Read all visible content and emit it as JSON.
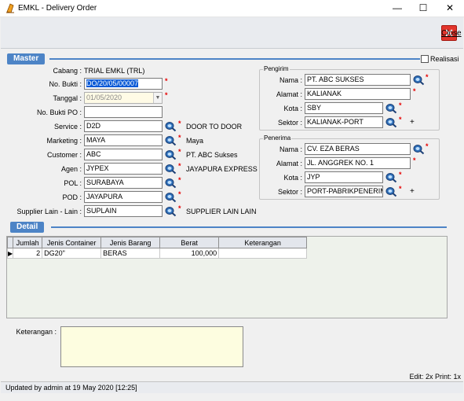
{
  "window": {
    "title": "EMKL - Delivery Order",
    "minimize": "—",
    "maximize": "☐",
    "close": "✕"
  },
  "toolbar": {
    "close_label": "Close"
  },
  "master": {
    "section_label": "Master",
    "realisasi_label": "Realisasi",
    "cabang_label": "Cabang :",
    "cabang_value": "TRIAL EMKL (TRL)",
    "no_bukti_label": "No. Bukti :",
    "no_bukti_value": "DO/20/05/00007",
    "tanggal_label": "Tanggal :",
    "tanggal_value": "01/05/2020",
    "no_bukti_po_label": "No. Bukti PO :",
    "no_bukti_po_value": "",
    "service_label": "Service :",
    "service_value": "D2D",
    "service_desc": "DOOR TO DOOR",
    "marketing_label": "Marketing :",
    "marketing_value": "MAYA",
    "marketing_desc": "Maya",
    "customer_label": "Customer :",
    "customer_value": "ABC",
    "customer_desc": "PT. ABC Sukses",
    "agen_label": "Agen :",
    "agen_value": "JYPEX",
    "agen_desc": "JAYAPURA EXPRESS",
    "pol_label": "POL :",
    "pol_value": "SURABAYA",
    "pod_label": "POD :",
    "pod_value": "JAYAPURA",
    "supplier_label": "Supplier Lain - Lain :",
    "supplier_value": "SUPLAIN",
    "supplier_desc": "SUPPLIER LAIN LAIN"
  },
  "pengirim": {
    "title": "Pengirim",
    "nama_label": "Nama :",
    "nama_value": "PT. ABC SUKSES",
    "alamat_label": "Alamat :",
    "alamat_value": "KALIANAK",
    "kota_label": "Kota :",
    "kota_value": "SBY",
    "sektor_label": "Sektor :",
    "sektor_value": "KALIANAK-PORT"
  },
  "penerima": {
    "title": "Penerima",
    "nama_label": "Nama :",
    "nama_value": "CV. EZA BERAS",
    "alamat_label": "Alamat :",
    "alamat_value": "JL. ANGGREK NO. 1",
    "kota_label": "Kota :",
    "kota_value": "JYP",
    "sektor_label": "Sektor :",
    "sektor_value": "PORT-PABRIKPENERIMA"
  },
  "marks": {
    "required": "*",
    "plus": "+"
  },
  "detail": {
    "section_label": "Detail",
    "columns": [
      "Jumlah",
      "Jenis Container",
      "Jenis Barang",
      "Berat",
      "Keterangan"
    ],
    "rows": [
      {
        "jumlah": "2",
        "jenis_container": "DG20\"",
        "jenis_barang": "BERAS",
        "berat": "100,000",
        "keterangan": ""
      }
    ]
  },
  "keterangan": {
    "label": "Keterangan :",
    "value": ""
  },
  "footer": {
    "edit_print": "Edit: 2x Print: 1x",
    "status": "Updated by admin at 19 May 2020 [12:25]"
  },
  "colors": {
    "section": "#4d84c6",
    "required": "#e60000",
    "close_button": "#e2352c",
    "selection": "#0a5ad6",
    "memo": "#fdfde0"
  }
}
